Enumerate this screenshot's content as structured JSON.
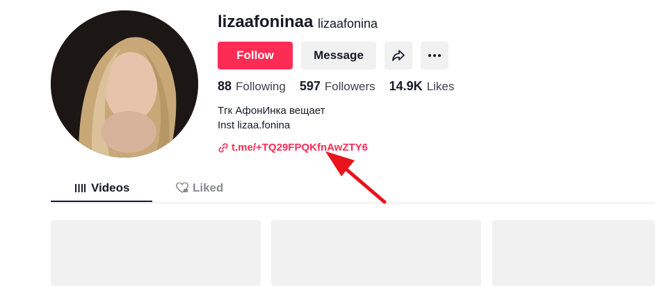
{
  "profile": {
    "username": "lizaafoninaa",
    "nickname": "lizaafonina",
    "follow_label": "Follow",
    "message_label": "Message",
    "stats": {
      "following_count": "88",
      "following_label": "Following",
      "followers_count": "597",
      "followers_label": "Followers",
      "likes_count": "14.9K",
      "likes_label": "Likes"
    },
    "bio_line1": "Тгк АфонИнка вещает",
    "bio_line2": "Inst lizaa.fonina",
    "link_text": "t.me/+TQ29FPQKfnAwZTY6"
  },
  "tabs": {
    "videos": "Videos",
    "liked": "Liked"
  },
  "colors": {
    "accent": "#fe2c55",
    "annotation_arrow": "#e8131b"
  }
}
